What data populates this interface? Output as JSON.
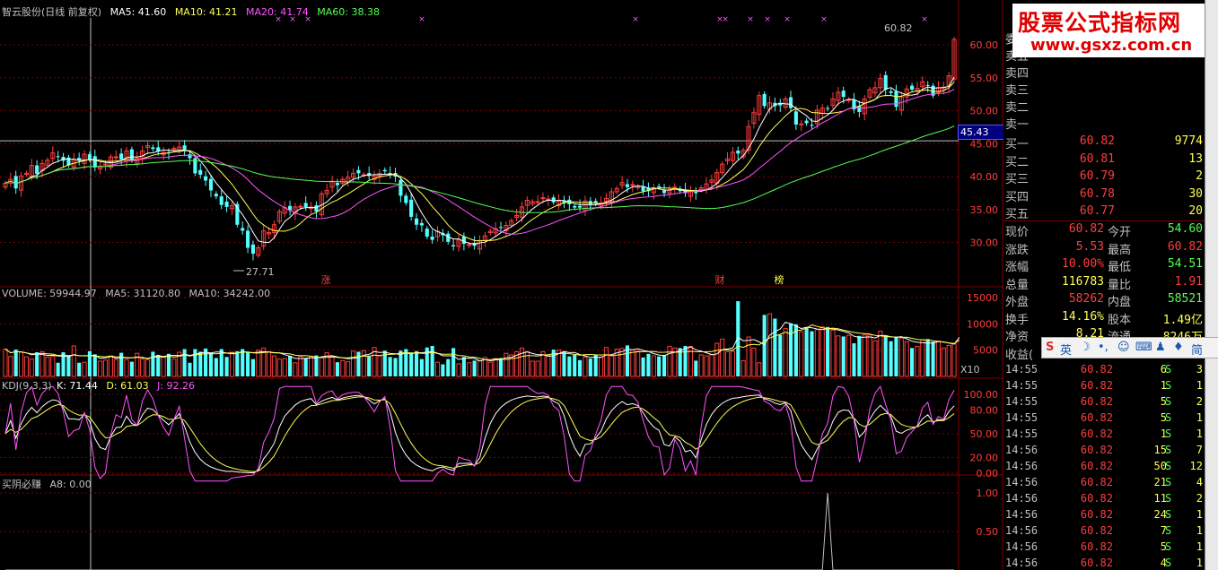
{
  "headers": {
    "main": {
      "stock": "智云股份(日线 前复权)",
      "ma5": "MA5: 41.60",
      "ma10": "MA10: 41.21",
      "ma20": "MA20: 41.74",
      "ma60": "MA60: 38.38"
    },
    "volume": {
      "label": "VOLUME: 59944.97",
      "ma5": "MA5: 31120.80",
      "ma10": "MA10: 34242.00"
    },
    "kdj": {
      "label": "KDJ(9,3,3)",
      "k": "K: 71.44",
      "d": "D: 61.03",
      "j": "J: 92.26"
    },
    "ind": {
      "label": "买阴必赚",
      "a8": "A8: 0.00"
    }
  },
  "colors": {
    "up": "#ff3d3d",
    "down": "#54ffff",
    "ma5": "#ffffff",
    "ma10": "#ffff54",
    "ma20": "#ff54ff",
    "ma60": "#54ff54",
    "grid": "#800000"
  },
  "axes": {
    "price_ticks": [
      "60.00",
      "55.00",
      "50.00",
      "45.00",
      "40.00",
      "35.00",
      "30.00"
    ],
    "volume_ticks": [
      "15000",
      "10000",
      "5000"
    ],
    "volume_unit": "X10",
    "kdj_ticks": [
      "100.00",
      "80.00",
      "50.00",
      "20.00",
      "0.00"
    ],
    "ind_ticks": [
      "1.00",
      "0.50"
    ]
  },
  "annotations": {
    "high": "60.82",
    "low": "27.71",
    "current_price_flag": "45.43",
    "markers": [
      "涨",
      "财",
      "榜"
    ]
  },
  "chart_data": [
    {
      "type": "candlestick",
      "ylabel": "",
      "ylim": [
        26,
        63
      ],
      "close": [
        39,
        39.6,
        38.2,
        40.1,
        40.5,
        41.7,
        40.4,
        42,
        42.5,
        43.6,
        43,
        42.4,
        41.7,
        42.6,
        42.5,
        43.4,
        42.6,
        41.4,
        41.6,
        41.9,
        43,
        43,
        42.6,
        43.9,
        42.5,
        42.8,
        43.9,
        44.7,
        44.2,
        43.8,
        43.7,
        43.6,
        44.3,
        44.5,
        43.9,
        42.8,
        40.5,
        40.3,
        39.4,
        37.9,
        37,
        35.7,
        35.4,
        35.6,
        32.7,
        31.8,
        29.2,
        28.3,
        29.2,
        31.8,
        31.5,
        32.7,
        34.7,
        35.3,
        34.9,
        35.4,
        35.5,
        35.4,
        35.4,
        34.7,
        37.4,
        37.9,
        39.3,
        38.7,
        39.6,
        39.9,
        40.5,
        40.5,
        40.3,
        40.1,
        40.1,
        40.5,
        40.8,
        40.3,
        40,
        37.1,
        36,
        33.9,
        32.7,
        32.6,
        30.9,
        30.4,
        31.7,
        31.1,
        30.1,
        29.4,
        30.4,
        29.8,
        29.7,
        29.5,
        30.3,
        31,
        31.7,
        32.1,
        32.3,
        32.6,
        33.3,
        34.1,
        35.4,
        36.4,
        36.2,
        36.2,
        36.8,
        36.6,
        36.1,
        36.3,
        36,
        35.8,
        35.3,
        35.3,
        36.3,
        35.8,
        35.9,
        36,
        36.7,
        37.7,
        38.2,
        39.1,
        38.4,
        38.8,
        38.5,
        37.8,
        37.8,
        38.3,
        38.4,
        37.5,
        37.9,
        38.4,
        37.8,
        37.5,
        37.8,
        37.5,
        38.3,
        38.9,
        39.5,
        40.6,
        41.9,
        42.7,
        43.7,
        43.5,
        44,
        47.6,
        49.7,
        52.3,
        50.7,
        51.2,
        50.7,
        50.8,
        51.8,
        50.4,
        47.9,
        48,
        48.1,
        47.8,
        50.1,
        50.4,
        50.3,
        51.8,
        52.8,
        52.1,
        51.7,
        50.2,
        49.8,
        51.8,
        53.2,
        53.5,
        54.9,
        53.2,
        52.7,
        50.6,
        52.1,
        53.3,
        53.2,
        53.4,
        54.4,
        53.8,
        52.3,
        53.5,
        53.6,
        55.3,
        60.82
      ]
    },
    {
      "type": "bar",
      "ylabel": "",
      "ylim": [
        0,
        15000
      ],
      "values": [
        5200,
        3800,
        5100,
        4600,
        3700,
        3300,
        4600,
        4700,
        3700,
        3800,
        2600,
        4600,
        4000,
        5800,
        2600,
        2700,
        4800,
        4200,
        2900,
        3100,
        3900,
        3200,
        4500,
        3200,
        2800,
        4400,
        3300,
        3200,
        4700,
        4100,
        3600,
        4300,
        3300,
        4600,
        5200,
        2600,
        5200,
        4700,
        5300,
        4500,
        3500,
        5200,
        3700,
        4600,
        4800,
        5200,
        4700,
        3300,
        5000,
        5400,
        4700,
        3900,
        3300,
        3400,
        3900,
        2600,
        3800,
        3500,
        3800,
        4000,
        3600,
        4500,
        3800,
        2700,
        3000,
        2800,
        4800,
        4700,
        4900,
        3800,
        5500,
        3900,
        4900,
        3700,
        3500,
        4900,
        5200,
        4300,
        4800,
        3300,
        5500,
        5800,
        2700,
        2300,
        3300,
        5400,
        2400,
        3700,
        2600,
        3000,
        3000,
        3600,
        2700,
        3400,
        3500,
        4400,
        4100,
        4700,
        5400,
        4700,
        2900,
        2900,
        4700,
        4000,
        5100,
        5000,
        4800,
        3800,
        4100,
        3100,
        3700,
        3400,
        4100,
        3700,
        5500,
        3900,
        5200,
        5300,
        5900,
        5100,
        4800,
        3600,
        4300,
        3900,
        3800,
        4100,
        5700,
        5400,
        5400,
        5800,
        5700,
        3000,
        4100,
        3900,
        4100,
        6300,
        7100,
        4700,
        4800,
        14300,
        3000,
        7500,
        5400,
        2600,
        11700,
        11900,
        11000,
        7900,
        9100,
        10100,
        9900,
        8500,
        9200,
        8600,
        8900,
        9400,
        9400,
        8800,
        7700,
        7600,
        7800,
        6300,
        7700,
        7900,
        7900,
        6800,
        8600,
        7700,
        6700,
        7500,
        7300,
        6600,
        5400,
        5700,
        7000,
        7100,
        6600,
        6700,
        5400,
        5900,
        6200,
        13000
      ]
    },
    {
      "type": "line",
      "name": "KDJ",
      "ylabel": "",
      "ylim": [
        0,
        100
      ],
      "k_last": 71.44,
      "d_last": 61.03,
      "j_last": 92.26
    },
    {
      "type": "line",
      "name": "A8",
      "ylabel": "",
      "ylim": [
        0,
        1
      ],
      "last": 0.0
    }
  ],
  "panel": {
    "sell_label": "委",
    "sells": [
      {
        "label": "卖五",
        "price": "",
        "vol": ""
      },
      {
        "label": "卖四",
        "price": "",
        "vol": ""
      },
      {
        "label": "卖三",
        "price": "",
        "vol": ""
      },
      {
        "label": "卖二",
        "price": "",
        "vol": ""
      },
      {
        "label": "卖一",
        "price": "",
        "vol": ""
      }
    ],
    "buys": [
      {
        "label": "买一",
        "price": "60.82",
        "vol": "9774"
      },
      {
        "label": "买二",
        "price": "60.81",
        "vol": "13"
      },
      {
        "label": "买三",
        "price": "60.79",
        "vol": "2"
      },
      {
        "label": "买四",
        "price": "60.78",
        "vol": "30"
      },
      {
        "label": "买五",
        "price": "60.77",
        "vol": "20"
      }
    ],
    "stats": [
      {
        "l1": "现价",
        "v1": "60.82",
        "c1": "#ff3d3d",
        "l2": "今开",
        "v2": "54.60",
        "c2": "#54ff54"
      },
      {
        "l1": "涨跌",
        "v1": "5.53",
        "c1": "#ff3d3d",
        "l2": "最高",
        "v2": "60.82",
        "c2": "#ff3d3d"
      },
      {
        "l1": "涨幅",
        "v1": "10.00%",
        "c1": "#ff3d3d",
        "l2": "最低",
        "v2": "54.51",
        "c2": "#54ff54"
      },
      {
        "l1": "总量",
        "v1": "116783",
        "c1": "#ffff54",
        "l2": "量比",
        "v2": "1.91",
        "c2": "#ff3d3d"
      },
      {
        "l1": "外盘",
        "v1": "58262",
        "c1": "#ff3d3d",
        "l2": "内盘",
        "v2": "58521",
        "c2": "#54ff54"
      },
      {
        "l1": "换手",
        "v1": "14.16%",
        "c1": "#ffff54",
        "l2": "股本",
        "v2": "1.49亿",
        "c2": "#ffff54"
      },
      {
        "l1": "净资",
        "v1": "8.21",
        "c1": "#ffff54",
        "l2": "流通",
        "v2": "8246万",
        "c2": "#ffff54"
      },
      {
        "l1": "收益(",
        "v1": "",
        "c1": "#ffff54",
        "l2": "",
        "v2": "",
        "c2": "#ffff54"
      }
    ],
    "ticks": [
      {
        "t": "14:55",
        "p": "60.82",
        "q": "6",
        "s": "S",
        "n": "3"
      },
      {
        "t": "14:55",
        "p": "60.82",
        "q": "1",
        "s": "S",
        "n": "1"
      },
      {
        "t": "14:55",
        "p": "60.82",
        "q": "5",
        "s": "S",
        "n": "2"
      },
      {
        "t": "14:55",
        "p": "60.82",
        "q": "5",
        "s": "S",
        "n": "1"
      },
      {
        "t": "14:55",
        "p": "60.82",
        "q": "1",
        "s": "S",
        "n": "1"
      },
      {
        "t": "14:56",
        "p": "60.82",
        "q": "15",
        "s": "S",
        "n": "7"
      },
      {
        "t": "14:56",
        "p": "60.82",
        "q": "50",
        "s": "S",
        "n": "12"
      },
      {
        "t": "14:56",
        "p": "60.82",
        "q": "21",
        "s": "S",
        "n": "4"
      },
      {
        "t": "14:56",
        "p": "60.82",
        "q": "11",
        "s": "S",
        "n": "2"
      },
      {
        "t": "14:56",
        "p": "60.82",
        "q": "24",
        "s": "S",
        "n": "1"
      },
      {
        "t": "14:56",
        "p": "60.82",
        "q": "7",
        "s": "S",
        "n": "1"
      },
      {
        "t": "14:56",
        "p": "60.82",
        "q": "5",
        "s": "S",
        "n": "1"
      },
      {
        "t": "14:56",
        "p": "60.82",
        "q": "4",
        "s": "S",
        "n": "1"
      }
    ]
  },
  "watermark": {
    "title": "股票公式指标网",
    "url": "www.gsxz.com.cn"
  },
  "ime": {
    "lang": "英",
    "simp": "简"
  }
}
